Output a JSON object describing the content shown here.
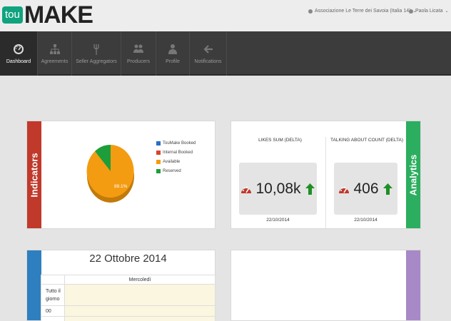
{
  "header": {
    "logo": {
      "prefix": "tou",
      "main": "MAKE"
    },
    "association": "Associazione Le Terre dei Savoia (Italia 14)",
    "user": "Paola Licata",
    "caret": "⌄"
  },
  "nav": [
    {
      "label": "Dashboard",
      "icon": "gauge-icon",
      "active": true
    },
    {
      "label": "Agreements",
      "icon": "sitemap-icon",
      "active": false
    },
    {
      "label": "Seller Aggregators",
      "icon": "fork-icon",
      "active": false
    },
    {
      "label": "Producers",
      "icon": "users-icon",
      "active": false
    },
    {
      "label": "Profile",
      "icon": "user-icon",
      "active": false
    },
    {
      "label": "Notifications",
      "icon": "arrow-left-icon",
      "active": false
    }
  ],
  "indicators": {
    "tab_label": "Indicators",
    "tab_color": "#c0392b",
    "pie_label": "88.1%",
    "legend": [
      {
        "label": "TouMake Booked",
        "color": "#2d6dc5"
      },
      {
        "label": "Internal Booked",
        "color": "#d9452b"
      },
      {
        "label": "Available",
        "color": "#f39c12"
      },
      {
        "label": "Reserved",
        "color": "#1e9e3a"
      }
    ]
  },
  "analytics": {
    "tab_label": "Analytics",
    "tab_color": "#2bae5f",
    "metrics": [
      {
        "title": "LIKES SUM (DELTA)",
        "value": "10,08k",
        "date": "22/10/2014"
      },
      {
        "title": "TALKING ABOUT COUNT (DELTA)",
        "value": "406",
        "date": "22/10/2014"
      }
    ]
  },
  "calendar": {
    "tab_color": "#2e7fbf",
    "title": "22 Ottobre 2014",
    "day": "Mercoledì",
    "rows": [
      {
        "label": "Tutto il giorno"
      },
      {
        "label": "00"
      },
      {
        "label": ""
      }
    ]
  },
  "empty_panel": {
    "tab_color": "#a889c7"
  }
}
